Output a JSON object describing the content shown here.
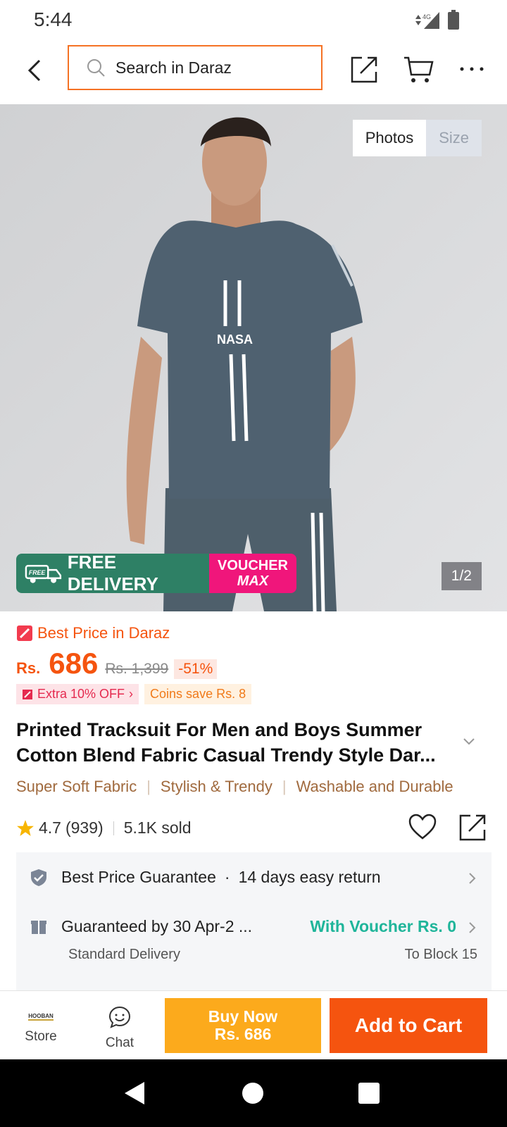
{
  "status_bar": {
    "time": "5:44",
    "network": "4G"
  },
  "header": {
    "search_placeholder": "Search in Daraz"
  },
  "gallery": {
    "tabs": [
      {
        "label": "Photos",
        "active": true
      },
      {
        "label": "Size",
        "active": false
      }
    ],
    "counter": "1/2",
    "banner": {
      "free_badge": "FREE",
      "free_text": "FREE DELIVERY",
      "voucher_line1": "VOUCHER",
      "voucher_line2": "MAX"
    },
    "shirt_print": "NASA"
  },
  "product": {
    "best_price_label": "Best Price in Daraz",
    "currency": "Rs.",
    "price": "686",
    "old_price": "Rs. 1,399",
    "discount": "-51%",
    "promo_extra": "Extra 10% OFF",
    "promo_coins": "Coins save Rs. 8",
    "title": "Printed Tracksuit For Men and Boys Summer Cotton Blend Fabric Casual Trendy Style Dar...",
    "features": [
      "Super Soft Fabric",
      "Stylish & Trendy",
      "Washable and Durable"
    ],
    "rating": "4.7",
    "rating_count": "(939)",
    "sold": "5.1K sold"
  },
  "services": {
    "guarantee": "Best Price Guarantee",
    "return_policy": "14 days easy return",
    "delivery_date": "Guaranteed by 30 Apr-2 ...",
    "voucher": "With Voucher Rs. 0",
    "delivery_type": "Standard Delivery",
    "destination": "To Block 15"
  },
  "bottom_bar": {
    "store_label": "Store",
    "store_logo_text": "HOOBAN",
    "chat_label": "Chat",
    "buy_now_line1": "Buy Now",
    "buy_now_line2": "Rs. 686",
    "add_to_cart": "Add to Cart"
  },
  "colors": {
    "accent": "#f5540f",
    "buy_now": "#fcaa1c",
    "voucher_green": "#1fb59a",
    "delivery_green": "#2e8065",
    "voucher_pink": "#f0167b"
  }
}
